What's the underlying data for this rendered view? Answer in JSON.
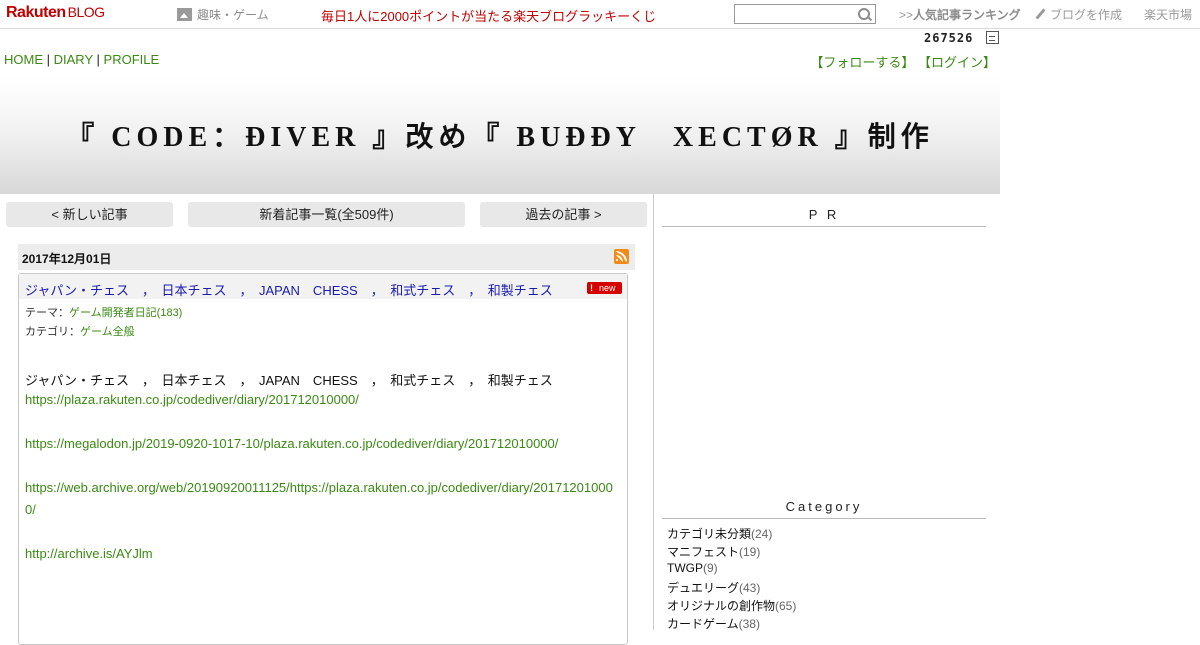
{
  "topbar": {
    "logo_brand": "Rakuten",
    "logo_product": "BLOG",
    "hobby_label": "趣味・ゲーム",
    "lottery_text": "毎日1人に2000ポイントが当たる楽天ブログラッキーくじ",
    "search_placeholder": "",
    "ranking_prefix": ">>",
    "ranking_label": "人気記事ランキング",
    "create_label": "ブログを作成",
    "market_label": "楽天市場"
  },
  "counter": {
    "value": "267526"
  },
  "nav": {
    "home": "HOME",
    "diary": "DIARY",
    "profile": "PROFILE",
    "sep": "|"
  },
  "follow": {
    "follow": "【フォローする】",
    "login": "【ログイン】"
  },
  "header": {
    "title": "『 CODE：ĐIVER 』改め『 BUĐĐY　XECTØR 』制作"
  },
  "pager": {
    "newer": "< 新しい記事",
    "list": "新着記事一覧(全509件)",
    "older": "過去の記事 >"
  },
  "entry": {
    "date": "2017年12月01日",
    "title": "ジャパン・チェス　，　日本チェス　，　JAPAN　CHESS　，　和式チェス　，　和製チェス",
    "badge_mark": "!",
    "badge_text": "new",
    "theme_label": "テーマ：",
    "theme_value": "ゲーム開発者日記(183)",
    "category_label": "カテゴリ：",
    "category_value": "ゲーム全般",
    "body_first": "ジャパン・チェス　，　日本チェス　，　JAPAN　CHESS　，　和式チェス　，　和製チェス",
    "links": [
      "https://plaza.rakuten.co.jp/codediver/diary/201712010000/",
      "https://megalodon.jp/2019-0920-1017-10/plaza.rakuten.co.jp/codediver/diary/201712010000/",
      "https://web.archive.org/web/20190920011125/https://plaza.rakuten.co.jp/codediver/diary/20171201000",
      "0/",
      "http://archive.is/AYJlm"
    ]
  },
  "sidebar": {
    "pr_heading": "P R",
    "category_heading": "Category",
    "categories": [
      {
        "name": "カテゴリ未分類",
        "count": "(24)"
      },
      {
        "name": "マニフェスト",
        "count": "(19)"
      },
      {
        "name": "TWGP",
        "count": "(9)"
      },
      {
        "name": "デュエリーグ",
        "count": "(43)"
      },
      {
        "name": "オリジナルの創作物",
        "count": "(65)"
      },
      {
        "name": "カードゲーム",
        "count": "(38)"
      }
    ]
  },
  "colors": {
    "brand_red": "#bf0000",
    "link_green": "#3a8a13",
    "title_blue": "#1a1ab0",
    "rss_orange": "#f18c18"
  }
}
